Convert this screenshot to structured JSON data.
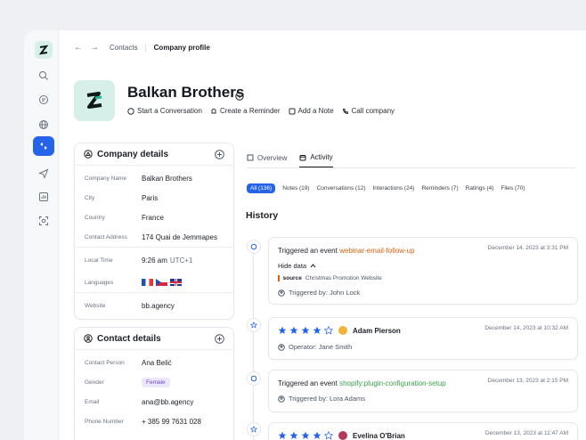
{
  "topbar": {
    "back": "←",
    "forward": "→",
    "crumb_contacts": "Contacts",
    "crumb_current": "Company profile"
  },
  "header": {
    "title": "Balkan Brothers",
    "actions": [
      "Start a Conversation",
      "Create a Reminder",
      "Add a Note",
      "Call company"
    ]
  },
  "company": {
    "title": "Company details",
    "rows": [
      {
        "k": "Company Name",
        "v": "Balkan Brothers"
      },
      {
        "k": "City",
        "v": "Paris"
      },
      {
        "k": "Country",
        "v": "France"
      },
      {
        "k": "Contact Address",
        "v": "174 Quai de Jemmapes"
      }
    ],
    "local_time_label": "Local Time",
    "local_time": "9:26 am",
    "tz": "UTC+1",
    "languages_label": "Languages",
    "website_label": "Website",
    "website": "bb.agency"
  },
  "contact": {
    "title": "Contact details",
    "person_label": "Contact Person",
    "person": "Ana Belić",
    "gender_label": "Gender",
    "gender": "Female",
    "email_label": "Email",
    "email": "ana@bb.agency",
    "phone_label": "Phone Number",
    "phone": "+ 385 99 7631 028"
  },
  "tabs": {
    "overview": "Overview",
    "activity": "Activity"
  },
  "filters": [
    "All (136)",
    "Notes (19)",
    "Conversations (12)",
    "Interactions (24)",
    "Reminders (7)",
    "Ratings (4)",
    "Files (70)"
  ],
  "history_title": "History",
  "events": {
    "e1": {
      "prefix": "Triggered an event",
      "name": "webinar-email-follow-up",
      "date": "December 14, 2023 at 3:31 PM",
      "hide": "Hide data",
      "source_key": "source",
      "source_val": "Christmas Promotion Website",
      "by": "Triggered by: John Lock"
    },
    "e2": {
      "rating": 4,
      "person": "Adam Pierson",
      "date": "December 14, 2023 at 10:32 AM",
      "operator": "Operator: Jane Smith"
    },
    "e3": {
      "prefix": "Triggered an event",
      "name": "shopify:plugin-configuration-setup",
      "date": "December 13, 2023 at 2:15 PM",
      "by": "Triggered by: Lora Adams"
    },
    "e4": {
      "rating": 4,
      "person": "Evelina O'Brian",
      "date": "December 13, 2023 at 11:47 AM"
    }
  },
  "colors": {
    "accent": "#2563eb",
    "brand_teal": "#1fb89a",
    "event_orange": "#d9600f",
    "event_green": "#3aa14b",
    "tag_bg": "#ede7fb"
  }
}
